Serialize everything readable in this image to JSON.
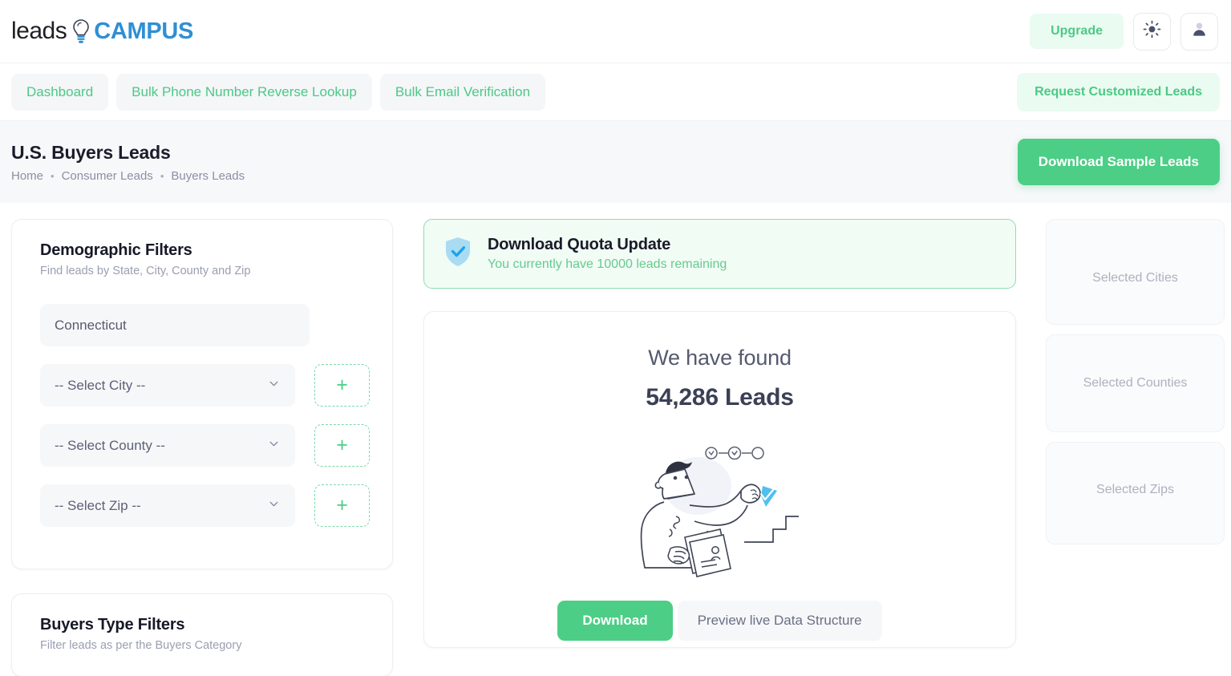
{
  "brand": {
    "name_part1": "leads",
    "name_part2": "CAMPUS",
    "bulb_icon": "lightbulb-icon",
    "accent_green": "#4cce86",
    "accent_blue": "#2f8fd4"
  },
  "topbar": {
    "upgrade_label": "Upgrade",
    "theme_icon": "sun-icon",
    "account_icon": "user-icon"
  },
  "nav": {
    "items": [
      {
        "label": "Dashboard"
      },
      {
        "label": "Bulk Phone Number Reverse Lookup"
      },
      {
        "label": "Bulk Email Verification"
      }
    ],
    "request_label": "Request Customized Leads"
  },
  "pagehead": {
    "title": "U.S. Buyers Leads",
    "breadcrumb": [
      {
        "label": "Home"
      },
      {
        "label": "Consumer Leads"
      },
      {
        "label": "Buyers Leads"
      }
    ],
    "separator": "•",
    "download_sample_label": "Download Sample Leads"
  },
  "demographic_filters": {
    "title": "Demographic Filters",
    "subtitle": "Find leads by State, City, County and Zip",
    "state_value": "Connecticut",
    "rows": [
      {
        "value": "-- Select City --",
        "chevron_icon": "chevron-down-icon",
        "add_icon": "plus-icon"
      },
      {
        "value": "-- Select County --",
        "chevron_icon": "chevron-down-icon",
        "add_icon": "plus-icon"
      },
      {
        "value": "-- Select Zip --",
        "chevron_icon": "chevron-down-icon",
        "add_icon": "plus-icon"
      }
    ]
  },
  "buyers_filters": {
    "title": "Buyers Type Filters",
    "subtitle": "Filter leads as per the Buyers Category"
  },
  "quota": {
    "icon": "shield-check-icon",
    "title": "Download Quota Update",
    "subtitle": "You currently have 10000 leads remaining"
  },
  "result": {
    "found_label": "We have found",
    "count_label": "54,286 Leads",
    "illustration": "person-with-documents-illustration",
    "download_label": "Download",
    "preview_label": "Preview live Data Structure"
  },
  "selected_panels": [
    {
      "label": "Selected Cities"
    },
    {
      "label": "Selected Counties"
    },
    {
      "label": "Selected Zips"
    }
  ]
}
